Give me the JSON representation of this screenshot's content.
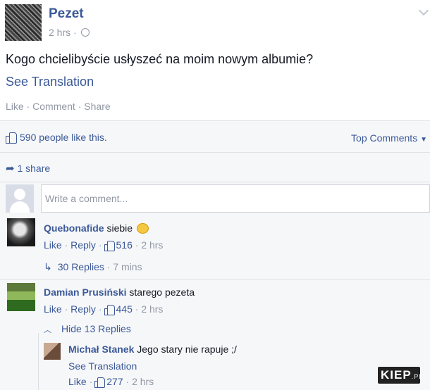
{
  "post": {
    "author": "Pezet",
    "time": "2 hrs",
    "separator": "·",
    "text": "Kogo chcielibyście usłyszeć na moim nowym albumie?",
    "see_translation": "See Translation",
    "actions": {
      "like": "Like",
      "comment": "Comment",
      "share": "Share",
      "sep": "·"
    },
    "icons": {
      "audience": "globe-icon",
      "menu": "chevron-down-icon"
    }
  },
  "ufi": {
    "likes_text": "590 people like this.",
    "top_comments": "Top Comments",
    "shares_text": "1 share",
    "comment_placeholder": "Write a comment...",
    "icons": {
      "like": "thumbs-up-icon",
      "share": "share-arrow-icon"
    }
  },
  "comments": [
    {
      "name": "Quebonafide",
      "text": "siebie",
      "like": "Like",
      "reply": "Reply",
      "likes": "516",
      "time": "2 hrs",
      "replies_label": "30 Replies",
      "replies_time": "7 mins",
      "emoji": "smiley-emoji-icon"
    },
    {
      "name": "Damian Prusiński",
      "text": "starego pezeta",
      "like": "Like",
      "reply": "Reply",
      "likes": "445",
      "time": "2 hrs",
      "replies_label": "Hide 13 Replies"
    }
  ],
  "reply": {
    "name": "Michał Stanek",
    "text": "Jego stary nie rapuje ;/",
    "see_translation": "See Translation",
    "like": "Like",
    "likes": "277",
    "time": "2 hrs"
  },
  "watermark": {
    "main": "KIEP",
    "suffix": ".PL"
  }
}
